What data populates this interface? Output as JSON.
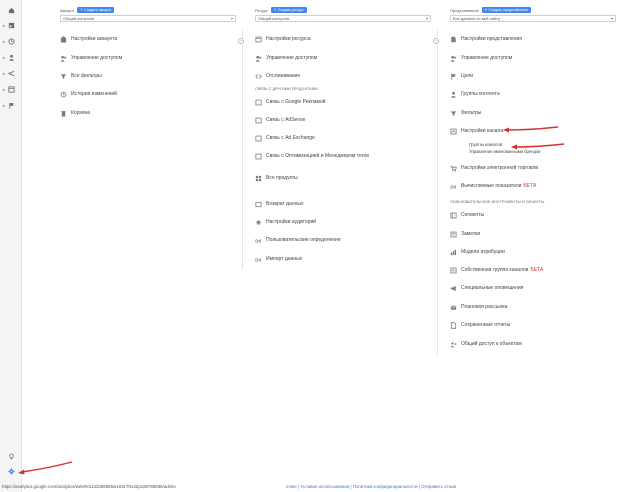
{
  "colors": {
    "accent": "#4285f4",
    "arrow": "#d32f2f",
    "new_badge": "#d33333"
  },
  "sidebar": {
    "items": [
      {
        "icon": "home-icon"
      },
      {
        "icon": "dashboard-icon"
      },
      {
        "icon": "clock-icon"
      },
      {
        "icon": "person-icon"
      },
      {
        "icon": "acquisition-icon"
      },
      {
        "icon": "behavior-icon"
      },
      {
        "icon": "flag-icon"
      }
    ],
    "bottom": [
      {
        "icon": "lightbulb-icon"
      },
      {
        "icon": "gear-icon"
      }
    ]
  },
  "account": {
    "label": "Аккаунт",
    "create_label": "Создать аккаунт",
    "selector": "Общий контроля",
    "items": [
      {
        "label": "Настройки аккаунта",
        "icon": "building-icon"
      },
      {
        "label": "Управление доступом",
        "icon": "users-icon"
      },
      {
        "label": "Все фильтры",
        "icon": "filter-icon"
      },
      {
        "label": "История изменений",
        "icon": "history-icon"
      },
      {
        "label": "Корзина",
        "icon": "trash-icon"
      }
    ]
  },
  "property": {
    "label": "Ресурс",
    "create_label": "Создать ресурс",
    "selector": "Общий контроля",
    "items": [
      {
        "label": "Настройки ресурса",
        "icon": "property-icon"
      },
      {
        "label": "Управление доступом",
        "icon": "users-icon"
      },
      {
        "label": "Отслеживание",
        "icon": "code-icon"
      }
    ],
    "section_title": "СВЯЗЬ С ДРУГИМИ ПРОДУКТАМИ",
    "links": [
      {
        "label": "Связь с Google Рекламой",
        "icon": "link-icon"
      },
      {
        "label": "Связь с AdSense",
        "icon": "link-icon"
      },
      {
        "label": "Связь с Ad Exchange",
        "icon": "link-icon"
      },
      {
        "label": "Связь с Оптимизацией и Менеджером тегов",
        "icon": "link-icon"
      },
      {
        "label": "Все продукты",
        "icon": "grid-icon"
      }
    ],
    "more": [
      {
        "label": "Возврат данных",
        "icon": "return-icon"
      },
      {
        "label": "Настройки аудиторий",
        "icon": "audience-icon"
      },
      {
        "label": "Пользовательские определения",
        "icon": "dd-icon"
      },
      {
        "label": "Импорт данных",
        "icon": "dd-icon"
      }
    ]
  },
  "view": {
    "label": "Представление",
    "create_label": "Создать представление",
    "selector": "Все данные по веб-сайту",
    "items": [
      {
        "label": "Настройки представления",
        "icon": "doc-icon"
      },
      {
        "label": "Управление доступом",
        "icon": "users-icon"
      },
      {
        "label": "Цели",
        "icon": "flag-icon"
      },
      {
        "label": "Группы контента",
        "icon": "person-icon"
      },
      {
        "label": "Фильтры",
        "icon": "filter-icon"
      },
      {
        "label": "Настройки канала",
        "icon": "channel-icon"
      }
    ],
    "channel_sub": [
      "Группы каналов",
      "Управление именованными брендов"
    ],
    "ecommerce": {
      "label": "Настройки электронной торговли",
      "icon": "cart-icon"
    },
    "calc": {
      "label": "Вычисляемые показатели",
      "badge": "БЕТА",
      "icon": "dd-icon"
    },
    "section_title": "ПОЛЬЗОВАТЕЛЬСКИЕ ИНСТРУМЕНТЫ И ОБЪЕКТЫ",
    "tools": [
      {
        "label": "Сегменты",
        "icon": "segment-icon"
      },
      {
        "label": "Заметки",
        "icon": "note-icon"
      },
      {
        "label": "Модели атрибуции",
        "icon": "bar-icon"
      },
      {
        "label": "Собственная группа каналов",
        "badge": "БЕТА",
        "icon": "channel-icon"
      },
      {
        "label": "Специальные оповещения",
        "icon": "megaphone-icon"
      },
      {
        "label": "Плановая рассылка",
        "icon": "mail-icon"
      },
      {
        "label": "Сохраненные отчеты",
        "icon": "doc-icon"
      },
      {
        "label": "Общий доступ к объектам",
        "icon": "share-icon"
      }
    ]
  },
  "footer": {
    "url": "https://analytics.google.com/analytics/web/#/a133356856w193179142p188768938/admin",
    "links": "©2022 Google | Домашняя страница Аналитики | Условия использования | Политика конфиденциальности | Отправить отзыв",
    "visible_links": "ктике | Условия использования | Политика конфиденциальности | Отправить отзыв"
  }
}
